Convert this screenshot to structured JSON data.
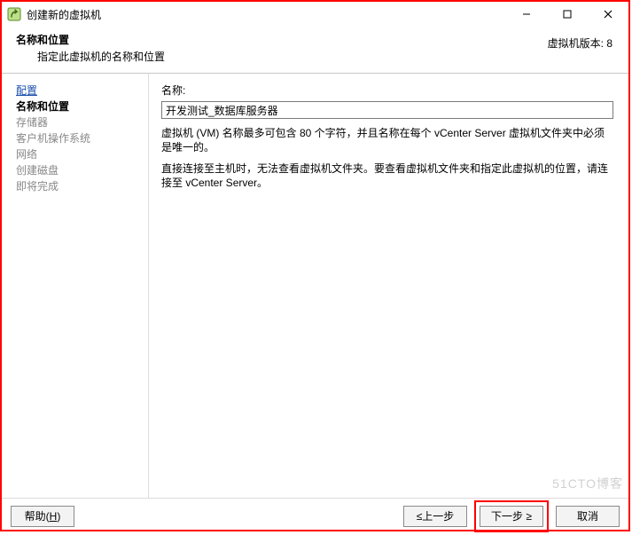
{
  "window": {
    "title": "创建新的虚拟机",
    "version_label": "虚拟机版本: 8"
  },
  "header": {
    "title": "名称和位置",
    "subtitle": "指定此虚拟机的名称和位置"
  },
  "sidebar": {
    "steps": [
      {
        "label": "配置",
        "state": "link"
      },
      {
        "label": "名称和位置",
        "state": "current"
      },
      {
        "label": "存储器",
        "state": "disabled"
      },
      {
        "label": "客户机操作系统",
        "state": "disabled"
      },
      {
        "label": "网络",
        "state": "disabled"
      },
      {
        "label": "创建磁盘",
        "state": "disabled"
      },
      {
        "label": "即将完成",
        "state": "disabled"
      }
    ]
  },
  "main": {
    "name_label": "名称:",
    "name_value": "开发测试_数据库服务器",
    "hint1": "虚拟机 (VM) 名称最多可包含 80 个字符，并且名称在每个 vCenter Server 虚拟机文件夹中必须是唯一的。",
    "hint2": "直接连接至主机时，无法查看虚拟机文件夹。要查看虚拟机文件夹和指定此虚拟机的位置，请连接至 vCenter Server。"
  },
  "footer": {
    "help": "帮助(H)",
    "back": "≤上一步",
    "next": "下一步 ≥",
    "cancel": "取消"
  },
  "watermark": "51CTO博客"
}
